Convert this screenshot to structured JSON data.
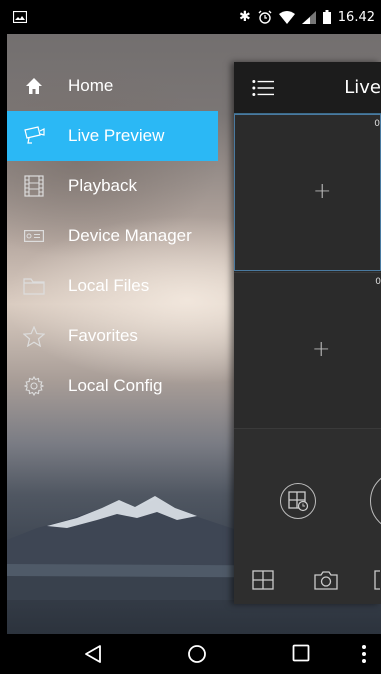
{
  "status_bar": {
    "time": "16.42",
    "icons": [
      "image-notification-icon",
      "bluetooth-icon",
      "alarm-icon",
      "wifi-icon",
      "signal-icon",
      "battery-icon"
    ]
  },
  "drawer": {
    "items": [
      {
        "label": "Home",
        "icon": "home-icon",
        "active": false
      },
      {
        "label": "Live Preview",
        "icon": "camera-icon",
        "active": true
      },
      {
        "label": "Playback",
        "icon": "film-icon",
        "active": false
      },
      {
        "label": "Device Manager",
        "icon": "device-icon",
        "active": false
      },
      {
        "label": "Local Files",
        "icon": "folder-icon",
        "active": false
      },
      {
        "label": "Favorites",
        "icon": "star-icon",
        "active": false
      },
      {
        "label": "Local Config",
        "icon": "gear-icon",
        "active": false
      }
    ]
  },
  "panel": {
    "title": "Live",
    "window_1_index": "0",
    "window_2_index": "0",
    "plus": "+"
  },
  "colors": {
    "accent": "#2bb8f5",
    "panel_bg": "#2a2a2a",
    "header_bg": "#1c1c1c"
  },
  "nav_bar": {
    "buttons": [
      "back-icon",
      "home-circle-icon",
      "recents-icon",
      "more-icon"
    ]
  }
}
